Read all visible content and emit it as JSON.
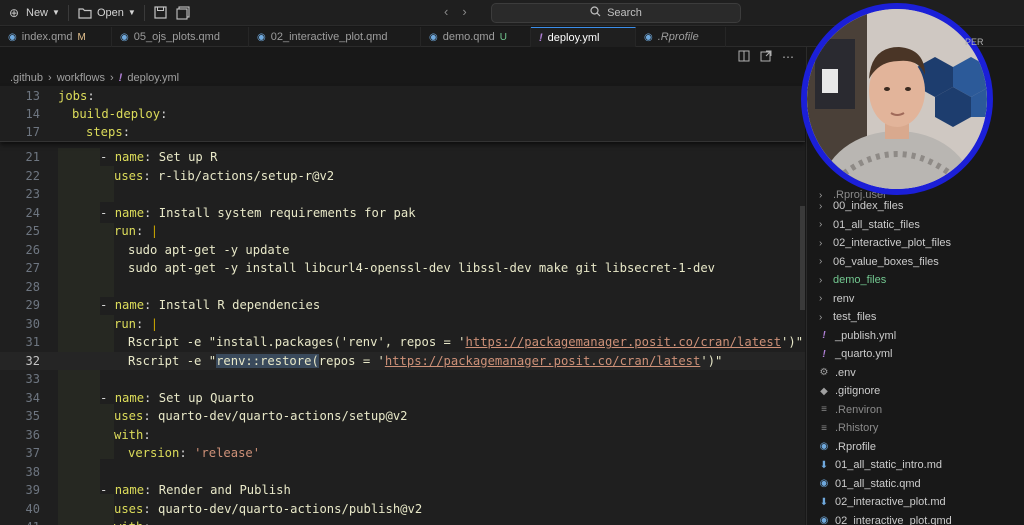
{
  "toolbar": {
    "new_label": "New",
    "open_label": "Open",
    "search_label": "Search"
  },
  "tabs": [
    {
      "label": "index.qmd",
      "badge": "M",
      "icon": "quarto-icon"
    },
    {
      "label": "05_ojs_plots.qmd",
      "badge": "",
      "icon": "quarto-icon"
    },
    {
      "label": "02_interactive_plot.qmd",
      "badge": "",
      "icon": "quarto-icon"
    },
    {
      "label": "demo.qmd",
      "badge": "U",
      "icon": "quarto-icon"
    },
    {
      "label": "deploy.yml",
      "badge": "",
      "icon": "yaml-icon",
      "active": true
    },
    {
      "label": ".Rprofile",
      "badge": "",
      "icon": "r-icon"
    }
  ],
  "breadcrumb": {
    "a": ".github",
    "b": "workflows",
    "c": "deploy.yml"
  },
  "sidebar_header": "PER",
  "code_lines": {
    "l13": "13",
    "l14": "14",
    "l17": "17",
    "l21": "21",
    "l22": "22",
    "l23": "23",
    "l24": "24",
    "l25": "25",
    "l26": "26",
    "l27": "27",
    "l28": "28",
    "l29": "29",
    "l30": "30",
    "l31": "31",
    "l32": "32",
    "l33": "33",
    "l34": "34",
    "l35": "35",
    "l36": "36",
    "l37": "37",
    "l38": "38",
    "l39": "39",
    "l40": "40",
    "l41": "41"
  },
  "code": {
    "jobs": "jobs",
    "build_deploy": "build-deploy",
    "steps": "steps",
    "name_r": "Set up R",
    "uses_r": "r-lib/actions/setup-r@v2",
    "name_sys": "Install system requirements for pak",
    "cmd_update": "sudo apt-get -y update",
    "cmd_install": "sudo apt-get -y install libcurl4-openssl-dev libssl-dev make git libsecret-1-dev",
    "name_deps": "Install R dependencies",
    "rscript1_a": "Rscript -e \"install.packages('renv', repos = '",
    "url": "https://packagemanager.posit.co/cran/latest",
    "rscript1_b": "')\"",
    "rscript2_a": "Rscript -e \"",
    "rscript2_sel": "renv::restore(",
    "rscript2_b": "repos = '",
    "rscript2_c": "')\"",
    "name_quarto": "Set up Quarto",
    "uses_quarto": "quarto-dev/quarto-actions/setup@v2",
    "version_val": "'release'",
    "name_render": "Render and Publish",
    "uses_publish": "quarto-dev/quarto-actions/publish@v2"
  },
  "explorer": [
    {
      "label": ".Rproj.user",
      "kind": "folder",
      "style": "dim"
    },
    {
      "label": "00_index_files",
      "kind": "folder"
    },
    {
      "label": "01_all_static_files",
      "kind": "folder"
    },
    {
      "label": "02_interactive_plot_files",
      "kind": "folder"
    },
    {
      "label": "06_value_boxes_files",
      "kind": "folder"
    },
    {
      "label": "demo_files",
      "kind": "folder",
      "style": "green"
    },
    {
      "label": "renv",
      "kind": "folder"
    },
    {
      "label": "test_files",
      "kind": "folder"
    },
    {
      "label": "_publish.yml",
      "kind": "yaml"
    },
    {
      "label": "_quarto.yml",
      "kind": "yaml"
    },
    {
      "label": ".env",
      "kind": "gear"
    },
    {
      "label": ".gitignore",
      "kind": "git"
    },
    {
      "label": ".Renviron",
      "kind": "lines",
      "style": "dim"
    },
    {
      "label": ".Rhistory",
      "kind": "lines",
      "style": "dim"
    },
    {
      "label": ".Rprofile",
      "kind": "r"
    },
    {
      "label": "01_all_static_intro.md",
      "kind": "md"
    },
    {
      "label": "01_all_static.qmd",
      "kind": "quarto"
    },
    {
      "label": "02_interactive_plot.md",
      "kind": "md"
    },
    {
      "label": "02_interactive_plot.qmd",
      "kind": "quarto"
    }
  ]
}
